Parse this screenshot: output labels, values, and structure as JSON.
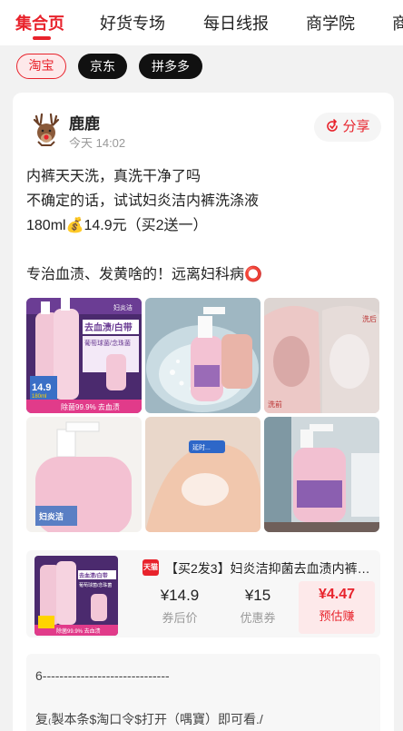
{
  "tabs": [
    "集合页",
    "好货专场",
    "每日线报",
    "商学院",
    "商"
  ],
  "chips": [
    "淘宝",
    "京东",
    "拼多多"
  ],
  "post": {
    "author": "鹿鹿",
    "time": "今天 14:02",
    "share_label": "分享",
    "lines": [
      "内裤天天洗，真洗干净了吗",
      "不确定的话，试试妇炎洁内裤洗涤液",
      "180ml💰14.9元（买2送一）",
      "",
      "专治血渍、发黄啥的！远离妇科病⭕"
    ]
  },
  "images": [
    {
      "name": "product-photo-1",
      "labels": [
        "去血渍/白带",
        "葡萄球菌/念珠菌",
        "14.9",
        "180ml",
        "除菌99.9% 去血渍",
        "妇炎洁"
      ]
    },
    {
      "name": "product-photo-2",
      "labels": []
    },
    {
      "name": "product-photo-3",
      "labels": [
        "洗后",
        "洗前"
      ]
    },
    {
      "name": "product-photo-4",
      "labels": [
        "妇炎洁"
      ]
    },
    {
      "name": "product-photo-5",
      "labels": [
        "延时..."
      ]
    },
    {
      "name": "product-photo-6",
      "labels": []
    }
  ],
  "product": {
    "platform": "天猫",
    "title": "【买2发3】妇炎洁抑菌去血渍内裤清洗液",
    "thumb_labels": [
      "去血渍/白带",
      "葡萄球菌/念珠菌",
      "除菌99.9% 去血渍"
    ],
    "price_after_coupon": "¥14.9",
    "price_after_coupon_label": "券后价",
    "coupon": "¥15",
    "coupon_label": "优惠券",
    "earn": "¥4.47",
    "earn_label": "预估赚"
  },
  "tkl": {
    "line1": "6------------------------------",
    "line2": "复₍製本条$淘口令$打开（喁寶）即可看./"
  },
  "colors": {
    "accent": "#e8232c",
    "accent_bg": "#fde9ea",
    "card_bg": "#ffffff",
    "page_bg": "#f2f2f2"
  }
}
